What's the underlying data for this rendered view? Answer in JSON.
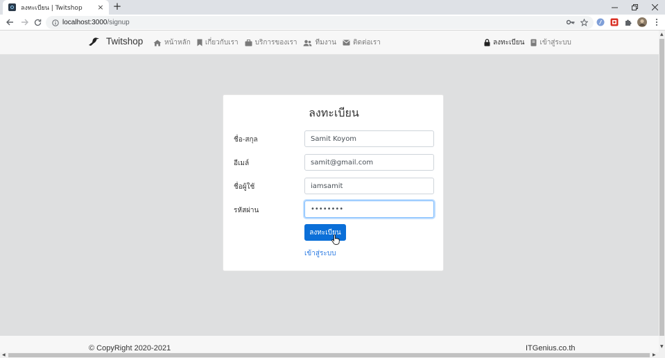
{
  "browser": {
    "tab_title": "ลงทะเบียน | Twitshop",
    "tab_close": "×",
    "new_tab": "+",
    "url_host": "localhost:3000",
    "url_path": "/signup"
  },
  "navbar": {
    "brand": "Twitshop",
    "links": [
      {
        "label": "หน้าหลัก",
        "icon": "home-icon"
      },
      {
        "label": "เกี่ยวกับเรา",
        "icon": "bookmark-icon"
      },
      {
        "label": "บริการของเรา",
        "icon": "briefcase-icon"
      },
      {
        "label": "ทีมงาน",
        "icon": "users-icon"
      },
      {
        "label": "ติดต่อเรา",
        "icon": "envelope-icon"
      }
    ],
    "right_links": [
      {
        "label": "ลงทะเบียน",
        "icon": "lock-icon",
        "active": true
      },
      {
        "label": "เข้าสู่ระบบ",
        "icon": "book-icon",
        "active": false
      }
    ]
  },
  "form": {
    "title": "ลงทะเบียน",
    "fields": [
      {
        "label": "ชื่อ-สกุล",
        "value": "Samit Koyom"
      },
      {
        "label": "อีเมล์",
        "value": "samit@gmail.com"
      },
      {
        "label": "ชื่อผู้ใช้",
        "value": "iamsamit"
      },
      {
        "label": "รหัสผ่าน",
        "value": "••••••••"
      }
    ],
    "submit_label": "ลงทะเบียน",
    "login_link": "เข้าสู่ระบบ"
  },
  "footer": {
    "left": "© CopyRight 2020-2021",
    "right": "ITGenius.co.th"
  },
  "colors": {
    "primary": "#0b6fd8",
    "link": "#2a7ae2",
    "page_bg": "#dedfe0",
    "navbar_bg": "#f7f7f7"
  }
}
